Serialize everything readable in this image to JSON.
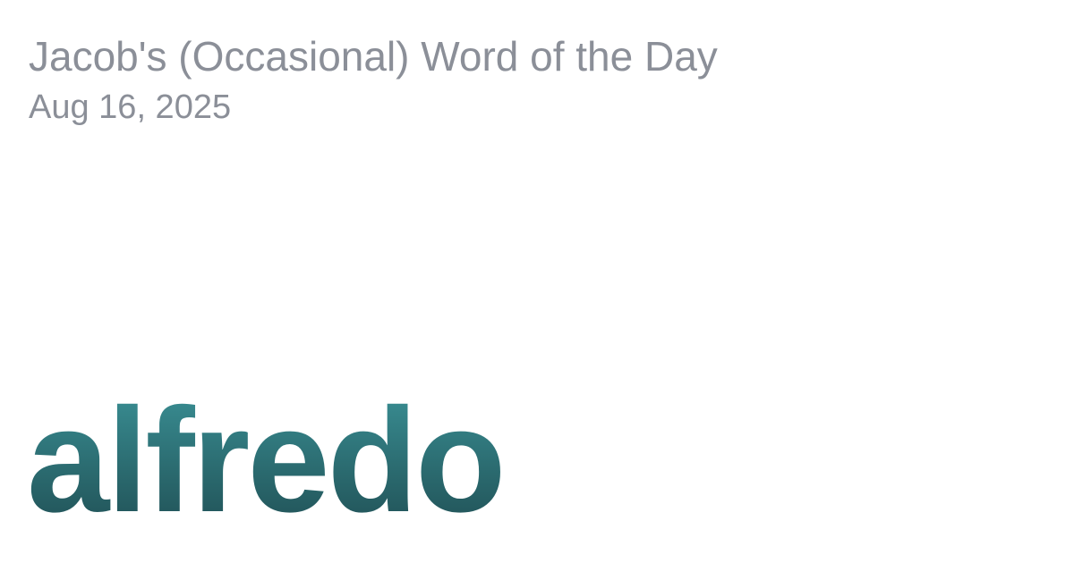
{
  "header": {
    "title": "Jacob's (Occasional) Word of the Day",
    "date": "Aug 16, 2025"
  },
  "word": {
    "text": "alfredo"
  },
  "colors": {
    "background": "#ffffff",
    "header_text": "#8b8f98",
    "word_gradient_top": "#3b9297",
    "word_gradient_bottom": "#1f4d52"
  }
}
